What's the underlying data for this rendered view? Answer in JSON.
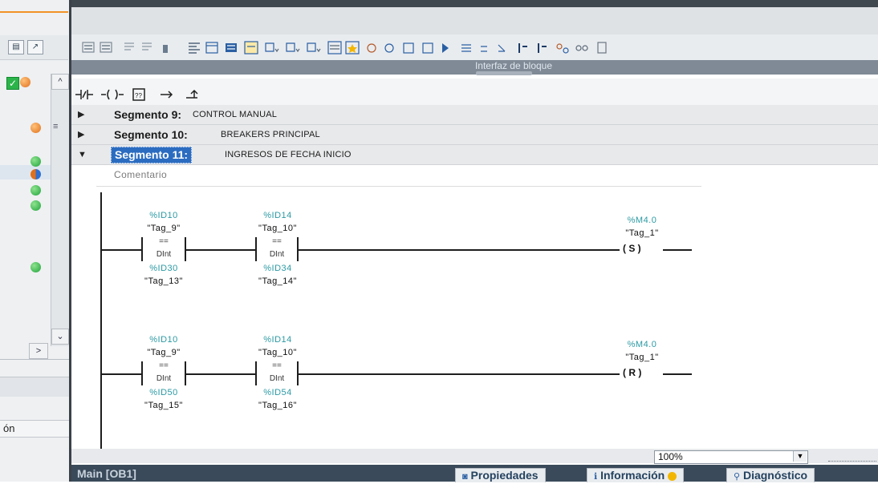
{
  "left_panel": {
    "bottom_label": "ón",
    "scroll_right": ">",
    "scroll_down": "⌄",
    "scroll_up": "^"
  },
  "interface_bar": {
    "label": "Interfaz de bloque"
  },
  "ladder_toolbar": {
    "items": [
      "⊣/⊢",
      "⊸",
      "??",
      "↦",
      "⌐"
    ]
  },
  "segments": [
    {
      "label": "Segmento 9:",
      "desc": "CONTROL MANUAL",
      "expanded": false
    },
    {
      "label": "Segmento 10:",
      "desc": "BREAKERS PRINCIPAL",
      "expanded": false
    },
    {
      "label": "Segmento 11:",
      "desc": "INGRESOS DE FECHA INICIO",
      "expanded": true
    }
  ],
  "comment": "Comentario",
  "network": {
    "rung1": {
      "c1": {
        "top_addr": "%ID10",
        "top_tag": "\"Tag_9\"",
        "op": "==",
        "type": "DInt",
        "bot_addr": "%ID30",
        "bot_tag": "\"Tag_13\""
      },
      "c2": {
        "top_addr": "%ID14",
        "top_tag": "\"Tag_10\"",
        "op": "==",
        "type": "DInt",
        "bot_addr": "%ID34",
        "bot_tag": "\"Tag_14\""
      },
      "coil": {
        "addr": "%M4.0",
        "tag": "\"Tag_1\"",
        "kind": "( S )"
      }
    },
    "rung2": {
      "c1": {
        "top_addr": "%ID10",
        "top_tag": "\"Tag_9\"",
        "op": "==",
        "type": "DInt",
        "bot_addr": "%ID50",
        "bot_tag": "\"Tag_15\""
      },
      "c2": {
        "top_addr": "%ID14",
        "top_tag": "\"Tag_10\"",
        "op": "==",
        "type": "DInt",
        "bot_addr": "%ID54",
        "bot_tag": "\"Tag_16\""
      },
      "coil": {
        "addr": "%M4.0",
        "tag": "\"Tag_1\"",
        "kind": "( R )"
      }
    }
  },
  "zoom": {
    "value": "100%",
    "dropdown_icon": "▼"
  },
  "status_bar": {
    "title": "Main [OB1]",
    "tabs": [
      "Propiedades",
      "Información",
      "Diagnóstico"
    ]
  },
  "icons": {
    "toolbar": [
      "insert-network-icon",
      "delete-network-icon",
      "insert-row-icon",
      "append-row-icon",
      "open-branch-icon",
      "close-branch-icon",
      "absolute-operand-icon",
      "favorites-icon",
      "comments-icon",
      "show-tags-icon",
      "tag-info-icon",
      "move-up-icon",
      "move-down-icon",
      "compare-icon",
      "monitor-icon",
      "online-icon",
      "go-online-icon",
      "breakpoint-icon",
      "watch-icon",
      "block-icon"
    ]
  },
  "colors": {
    "accent": "#f19226",
    "selection": "#2b6cc0",
    "address": "#2b9aa4",
    "status_bar": "#3a4a5a"
  }
}
